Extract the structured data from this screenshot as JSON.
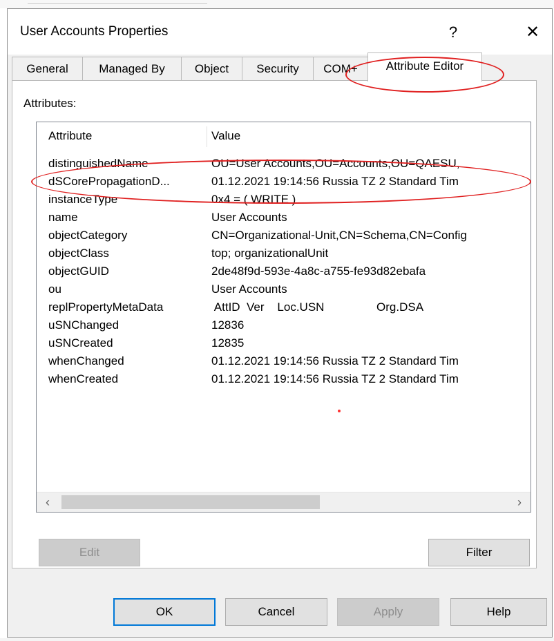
{
  "window": {
    "title": "User Accounts Properties",
    "help_label": "?",
    "close_label": "✕"
  },
  "tabs": [
    {
      "label": "General"
    },
    {
      "label": "Managed By"
    },
    {
      "label": "Object"
    },
    {
      "label": "Security"
    },
    {
      "label": "COM+"
    },
    {
      "label": "Attribute Editor",
      "active": true
    }
  ],
  "attributes_label": "Attributes:",
  "list": {
    "headers": {
      "attribute": "Attribute",
      "value": "Value"
    },
    "rows": [
      {
        "attribute": "distinguishedName",
        "value": "OU=User Accounts,OU=Accounts,OU=QAESU,"
      },
      {
        "attribute": "dSCorePropagationD...",
        "value": "01.12.2021 19:14:56 Russia TZ 2 Standard Tim"
      },
      {
        "attribute": "instanceType",
        "value": "0x4 = ( WRITE )"
      },
      {
        "attribute": "name",
        "value": "User Accounts"
      },
      {
        "attribute": "objectCategory",
        "value": "CN=Organizational-Unit,CN=Schema,CN=Config"
      },
      {
        "attribute": "objectClass",
        "value": "top; organizationalUnit"
      },
      {
        "attribute": "objectGUID",
        "value": "2de48f9d-593e-4a8c-a755-fe93d82ebafa"
      },
      {
        "attribute": "ou",
        "value": "User Accounts"
      },
      {
        "attribute": "replPropertyMetaData",
        "value": " AttID  Ver    Loc.USN                Org.DSA"
      },
      {
        "attribute": "uSNChanged",
        "value": "12836"
      },
      {
        "attribute": "uSNCreated",
        "value": "12835"
      },
      {
        "attribute": "whenChanged",
        "value": "01.12.2021 19:14:56 Russia TZ 2 Standard Tim"
      },
      {
        "attribute": "whenCreated",
        "value": "01.12.2021 19:14:56 Russia TZ 2 Standard Tim"
      }
    ],
    "scroll_left": "‹",
    "scroll_right": "›"
  },
  "buttons": {
    "edit": "Edit",
    "filter": "Filter",
    "ok": "OK",
    "cancel": "Cancel",
    "apply": "Apply",
    "help": "Help"
  },
  "colors": {
    "annotation": "#e02020",
    "default_button_border": "#0078d7"
  }
}
